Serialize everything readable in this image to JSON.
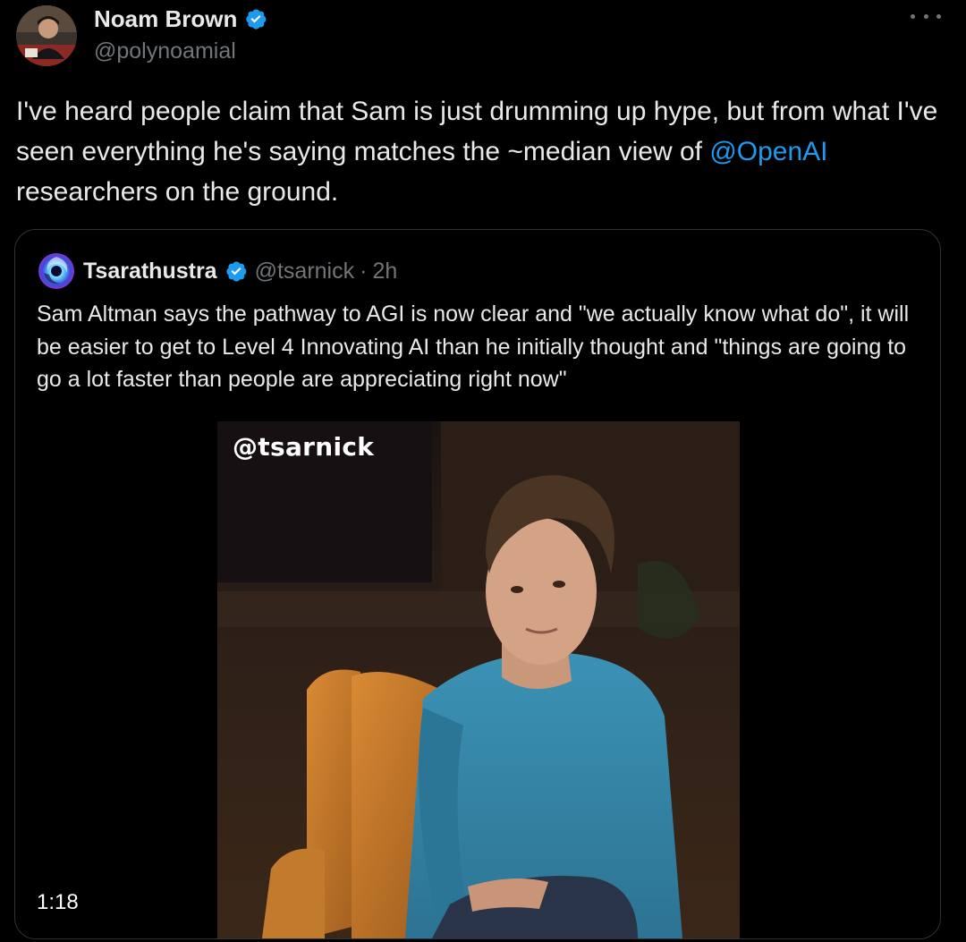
{
  "author": {
    "name": "Noam Brown",
    "handle": "@polynoamial",
    "verified": true
  },
  "tweet": {
    "text_part1": "I've heard people claim that Sam is just drumming up hype, but from what I've seen everything he's saying matches the ~median view of ",
    "mention": "@OpenAI",
    "text_part2": " researchers on the ground."
  },
  "quoted": {
    "name": "Tsarathustra",
    "handle": "@tsarnick",
    "separator": "·",
    "time": "2h",
    "verified": true,
    "text": "Sam Altman says the pathway to AGI is now clear and \"we actually know what do\", it will be easier to get to Level 4 Innovating AI than he initially thought and \"things are going to go a lot faster than people are appreciating right now\"",
    "media": {
      "watermark": "@tsarnick",
      "duration": "1:18"
    }
  },
  "colors": {
    "background": "#000000",
    "text_primary": "#e7e9ea",
    "text_secondary": "#71767b",
    "accent_link": "#1d9bf0",
    "border": "#2f3336",
    "verified_badge": "#1d9bf0"
  },
  "icons": [
    "verified-badge-icon",
    "more-options-icon"
  ]
}
